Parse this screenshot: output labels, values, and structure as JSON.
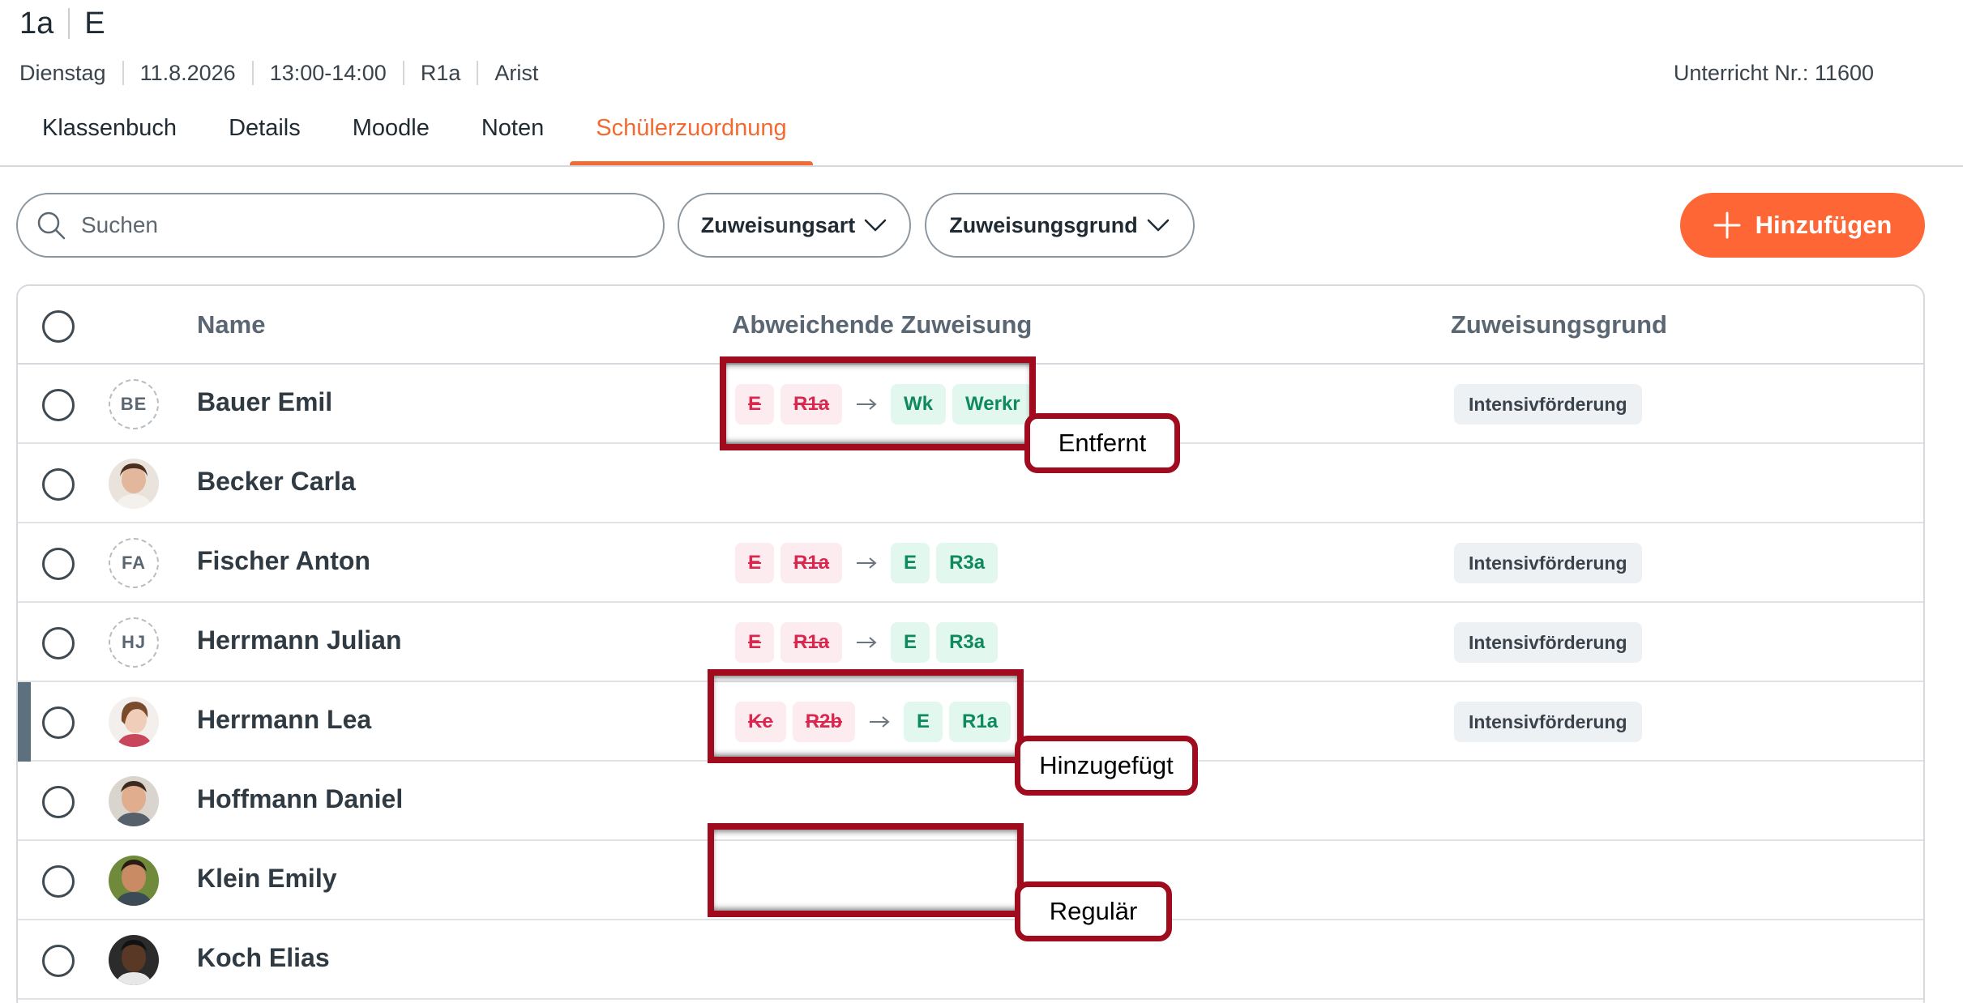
{
  "header": {
    "class": "1a",
    "subject": "E",
    "meta": [
      "Dienstag",
      "11.8.2026",
      "13:00-14:00",
      "R1a",
      "Arist"
    ],
    "lesson_number": "Unterricht Nr.: 11600"
  },
  "tabs": [
    {
      "label": "Klassenbuch",
      "active": false
    },
    {
      "label": "Details",
      "active": false
    },
    {
      "label": "Moodle",
      "active": false
    },
    {
      "label": "Noten",
      "active": false
    },
    {
      "label": "Schülerzuordnung",
      "active": true
    }
  ],
  "toolbar": {
    "search_placeholder": "Suchen",
    "filter_type": "Zuweisungsart",
    "filter_reason": "Zuweisungsgrund",
    "add_label": "Hinzufügen"
  },
  "table": {
    "col_name": "Name",
    "col_assignment": "Abweichende Zuweisung",
    "col_reason": "Zuweisungsgrund",
    "rows": [
      {
        "name": "Bauer Emil",
        "initials": "BE",
        "avatar": "initials",
        "old": [
          "E",
          "R1a"
        ],
        "new": [
          "Wk",
          "Werkr"
        ],
        "reason": "Intensivförderung"
      },
      {
        "name": "Becker Carla",
        "avatar": "photo",
        "old": [],
        "new": [],
        "reason": ""
      },
      {
        "name": "Fischer Anton",
        "initials": "FA",
        "avatar": "initials",
        "old": [
          "E",
          "R1a"
        ],
        "new": [
          "E",
          "R3a"
        ],
        "reason": "Intensivförderung"
      },
      {
        "name": "Herrmann Julian",
        "initials": "HJ",
        "avatar": "initials",
        "old": [
          "E",
          "R1a"
        ],
        "new": [
          "E",
          "R3a"
        ],
        "reason": "Intensivförderung"
      },
      {
        "name": "Herrmann Lea",
        "avatar": "photo",
        "old": [
          "Ke",
          "R2b"
        ],
        "new": [
          "E",
          "R1a"
        ],
        "reason": "Intensivförderung",
        "selected": true
      },
      {
        "name": "Hoffmann Daniel",
        "avatar": "photo",
        "old": [],
        "new": [],
        "reason": ""
      },
      {
        "name": "Klein Emily",
        "avatar": "photo",
        "old": [],
        "new": [],
        "reason": ""
      },
      {
        "name": "Koch Elias",
        "avatar": "photo",
        "old": [],
        "new": [],
        "reason": ""
      }
    ]
  },
  "annotations": {
    "removed": "Entfernt",
    "added": "Hinzugefügt",
    "regular": "Regulär"
  },
  "colors": {
    "accent": "#ff6635",
    "removed_text": "#d8284f",
    "added_text": "#0f8a5f",
    "annotation": "#a00c1e"
  },
  "icons": {
    "search": "search-icon",
    "dropdown": "chevron-down-icon",
    "add": "plus-icon",
    "arrow": "arrow-right-icon"
  }
}
